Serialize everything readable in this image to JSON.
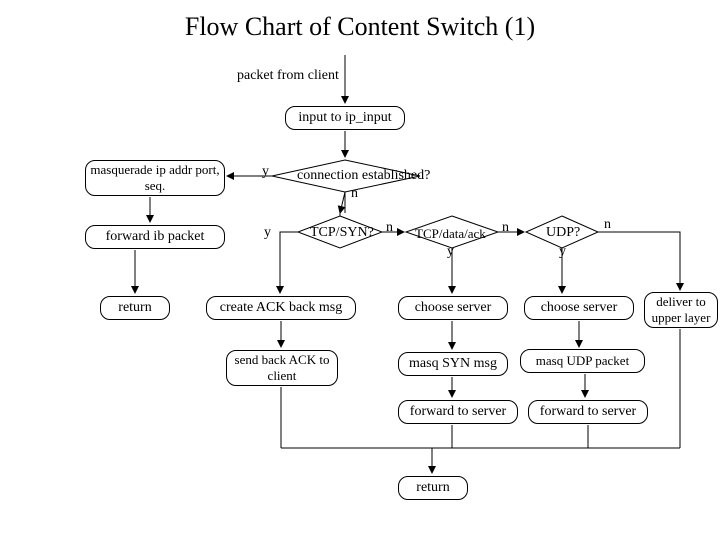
{
  "title": "Flow Chart of Content Switch (1)",
  "labels": {
    "packet_from_client": "packet from client",
    "y1": "y",
    "n1": "n",
    "y2": "y",
    "n2": "n",
    "y3": "y",
    "n3": "n",
    "y4": "y",
    "n4": "n"
  },
  "nodes": {
    "input_ip_input": "input to ip_input",
    "masq_ip": "masquerade ip addr port, seq.",
    "forward_ib": "forward ib packet",
    "return_left": "return",
    "conn_est": "connection established?",
    "tcp_syn": "TCP/SYN?",
    "tcp_data_ack": "TCP/data/ack",
    "udp": "UDP?",
    "create_ack": "create ACK back msg",
    "send_back_ack": "send back ACK to client",
    "choose_server_1": "choose server",
    "choose_server_2": "choose server",
    "deliver_upper": "deliver to upper layer",
    "masq_syn": "masq SYN msg",
    "masq_udp": "masq UDP packet",
    "fwd_server_1": "forward to server",
    "fwd_server_2": "forward to server",
    "return_bottom": "return"
  }
}
